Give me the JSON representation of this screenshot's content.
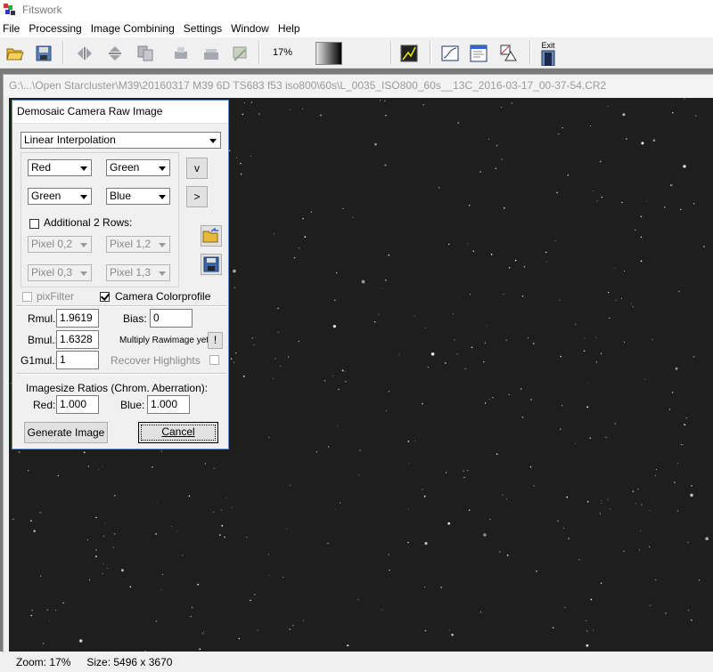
{
  "app": {
    "title": "Fitswork"
  },
  "menu": [
    "File",
    "Processing",
    "Image Combining",
    "Settings",
    "Window",
    "Help"
  ],
  "toolbar": {
    "zoom": "17%",
    "exit_label": "Exit"
  },
  "image_window": {
    "caption": "G:\\...\\Open Starcluster\\M39\\20160317 M39 6D TS683 f53 iso800\\60s\\L_0035_ISO800_60s__13C_2016-03-17_00-37-54.CR2"
  },
  "dialog": {
    "title": "Demosaic Camera Raw Image",
    "method": "Linear Interpolation",
    "row1": [
      "Red",
      "Green"
    ],
    "row2": [
      "Green",
      "Blue"
    ],
    "additional_rows_label": "Additional 2 Rows:",
    "row3": [
      "Pixel 0,2",
      "Pixel 1,2"
    ],
    "row4": [
      "Pixel 0,3",
      "Pixel 1,3"
    ],
    "btn_v": "v",
    "btn_next": ">",
    "pixfilter_label": "pixFilter",
    "camera_colorprofile_label": "Camera Colorprofile",
    "rmul_label": "Rmul.:",
    "rmul_value": "1.9619",
    "bias_label": "Bias:",
    "bias_value": "0",
    "bmul_label": "Bmul.:",
    "bmul_value": "1.6328",
    "multiply_label": "Multiply Rawimage yet:",
    "multiply_button": "!",
    "g1mul_label": "G1mul.:",
    "g1mul_value": "1",
    "recover_label": "Recover Highlights",
    "ratios_label": "Imagesize Ratios (Chrom. Aberration):",
    "red_label": "Red:",
    "red_value": "1.000",
    "blue_label": "Blue:",
    "blue_value": "1.000",
    "generate_button": "Generate Image",
    "cancel_button": "Cancel"
  },
  "status": {
    "zoom": "Zoom: 17%",
    "size": "Size: 5496 x 3670"
  }
}
